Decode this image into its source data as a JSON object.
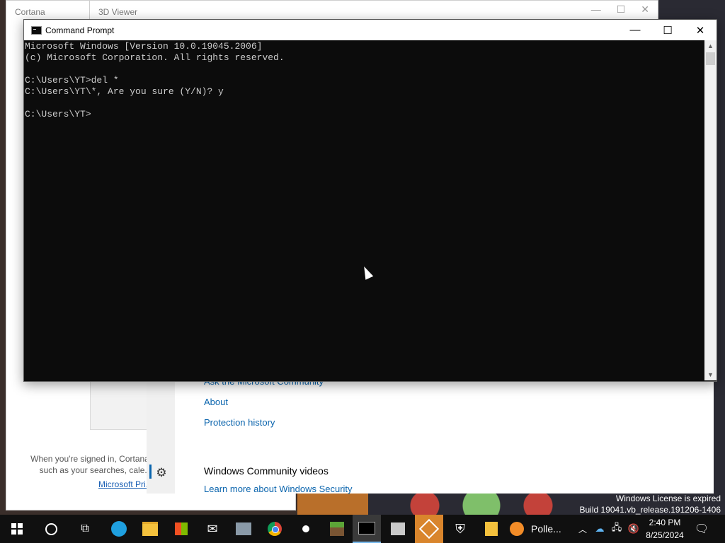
{
  "background_windows": {
    "cortana": {
      "title": "Cortana",
      "notice": "When you're signed in, Cortana l... such as your searches, cale...",
      "link": "Microsoft Pri..."
    },
    "viewer_3d": {
      "title": "3D Viewer"
    },
    "security": {
      "links": [
        "Ask the Microsoft Community",
        "About",
        "Protection history"
      ],
      "videos_heading": "Windows Community videos",
      "learn_more": "Learn more about Windows Security"
    }
  },
  "cmd": {
    "title": "Command Prompt",
    "lines": [
      "Microsoft Windows [Version 10.0.19045.2006]",
      "(c) Microsoft Corporation. All rights reserved.",
      "",
      "C:\\Users\\YT>del *",
      "C:\\Users\\YT\\*, Are you sure (Y/N)? y",
      "",
      "C:\\Users\\YT>"
    ]
  },
  "watermark": {
    "line1": "Windows License is expired",
    "line2": "Build 19041.vb_release.191206-1406"
  },
  "taskbar": {
    "pollen_label": "Polle...",
    "time": "2:40 PM",
    "date": "8/25/2024",
    "icons": [
      "start-icon",
      "search-icon",
      "task-view-icon",
      "edge-icon",
      "file-explorer-icon",
      "store-icon",
      "mail-icon",
      "app-icon",
      "chrome-icon",
      "app-icon",
      "minecraft-icon",
      "command-prompt-icon",
      "app-icon",
      "3d-viewer-icon",
      "windows-security-icon",
      "app-icon",
      "weather-icon"
    ]
  },
  "colors": {
    "console_bg": "#0c0c0c",
    "console_text": "#cccccc",
    "link_blue": "#0a64ad",
    "taskbar_bg": "#101010"
  }
}
